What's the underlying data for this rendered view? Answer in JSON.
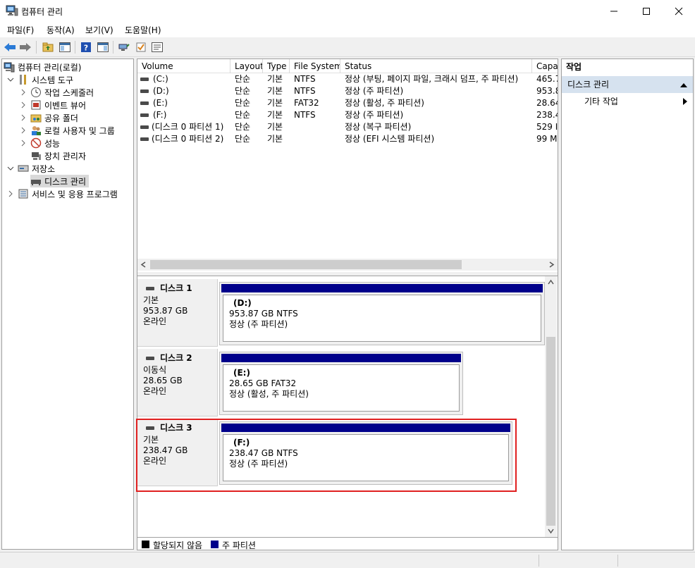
{
  "window": {
    "title": "컴퓨터 관리",
    "icons": {
      "app": "computer-management-icon",
      "minimize": "minimize-icon",
      "maximize": "maximize-icon",
      "close": "close-icon"
    }
  },
  "menu": [
    {
      "label": "파일(F)"
    },
    {
      "label": "동작(A)"
    },
    {
      "label": "보기(V)"
    },
    {
      "label": "도움말(H)"
    }
  ],
  "toolbar": [
    "back-icon",
    "forward-icon",
    "up-folder-icon",
    "show-hide-tree-icon",
    "help-icon",
    "show-hide-action-pane-icon",
    "connect-icon",
    "check-icon",
    "properties-icon"
  ],
  "tree": {
    "root": "컴퓨터 관리(로컬)",
    "system_tools": "시스템 도구",
    "task_scheduler": "작업 스케줄러",
    "event_viewer": "이벤트 뷰어",
    "shared_folders": "공유 폴더",
    "local_users": "로컬 사용자 및 그룹",
    "performance": "성능",
    "device_manager": "장치 관리자",
    "storage": "저장소",
    "disk_management": "디스크 관리",
    "services": "서비스 및 응용 프로그램"
  },
  "volume_list": {
    "columns": [
      "Volume",
      "Layout",
      "Type",
      "File System",
      "Status",
      "Capa"
    ],
    "rows": [
      {
        "volume": "(C:)",
        "layout": "단순",
        "type": "기본",
        "fs": "NTFS",
        "status": "정상 (부팅, 페이지 파일, 크래시 덤프, 주 파티션)",
        "capacity": "465.7"
      },
      {
        "volume": "(D:)",
        "layout": "단순",
        "type": "기본",
        "fs": "NTFS",
        "status": "정상 (주 파티션)",
        "capacity": "953.8"
      },
      {
        "volume": "(E:)",
        "layout": "단순",
        "type": "기본",
        "fs": "FAT32",
        "status": "정상 (활성, 주 파티션)",
        "capacity": "28.64"
      },
      {
        "volume": "(F:)",
        "layout": "단순",
        "type": "기본",
        "fs": "NTFS",
        "status": "정상 (주 파티션)",
        "capacity": "238.4"
      },
      {
        "volume": "(디스크 0 파티션 1)",
        "layout": "단순",
        "type": "기본",
        "fs": "",
        "status": "정상 (복구 파티션)",
        "capacity": "529 I"
      },
      {
        "volume": "(디스크 0 파티션 2)",
        "layout": "단순",
        "type": "기본",
        "fs": "",
        "status": "정상 (EFI 시스템 파티션)",
        "capacity": "99 M"
      }
    ]
  },
  "disks": [
    {
      "name": "디스크 1",
      "kind": "기본",
      "size": "953.87 GB",
      "state": "온라인",
      "partition": {
        "letter": "(D:)",
        "detail": "953.87 GB NTFS",
        "status": "정상 (주 파티션)"
      }
    },
    {
      "name": "디스크 2",
      "kind": "이동식",
      "size": "28.65 GB",
      "state": "온라인",
      "partition": {
        "letter": "(E:)",
        "detail": "28.65 GB FAT32",
        "status": "정상 (활성, 주 파티션)"
      }
    },
    {
      "name": "디스크 3",
      "kind": "기본",
      "size": "238.47 GB",
      "state": "온라인",
      "partition": {
        "letter": "(F:)",
        "detail": "238.47 GB NTFS",
        "status": "정상 (주 파티션)"
      }
    }
  ],
  "legend": [
    {
      "label": "할당되지 않음",
      "color": "#000000"
    },
    {
      "label": "주 파티션",
      "color": "#00008b"
    }
  ],
  "actions": {
    "title": "작업",
    "section": "디스크 관리",
    "item": "기타 작업"
  },
  "colors": {
    "highlight": "#e02020",
    "partition_bar": "#00008b",
    "action_section_bg": "#d6e2ef"
  }
}
